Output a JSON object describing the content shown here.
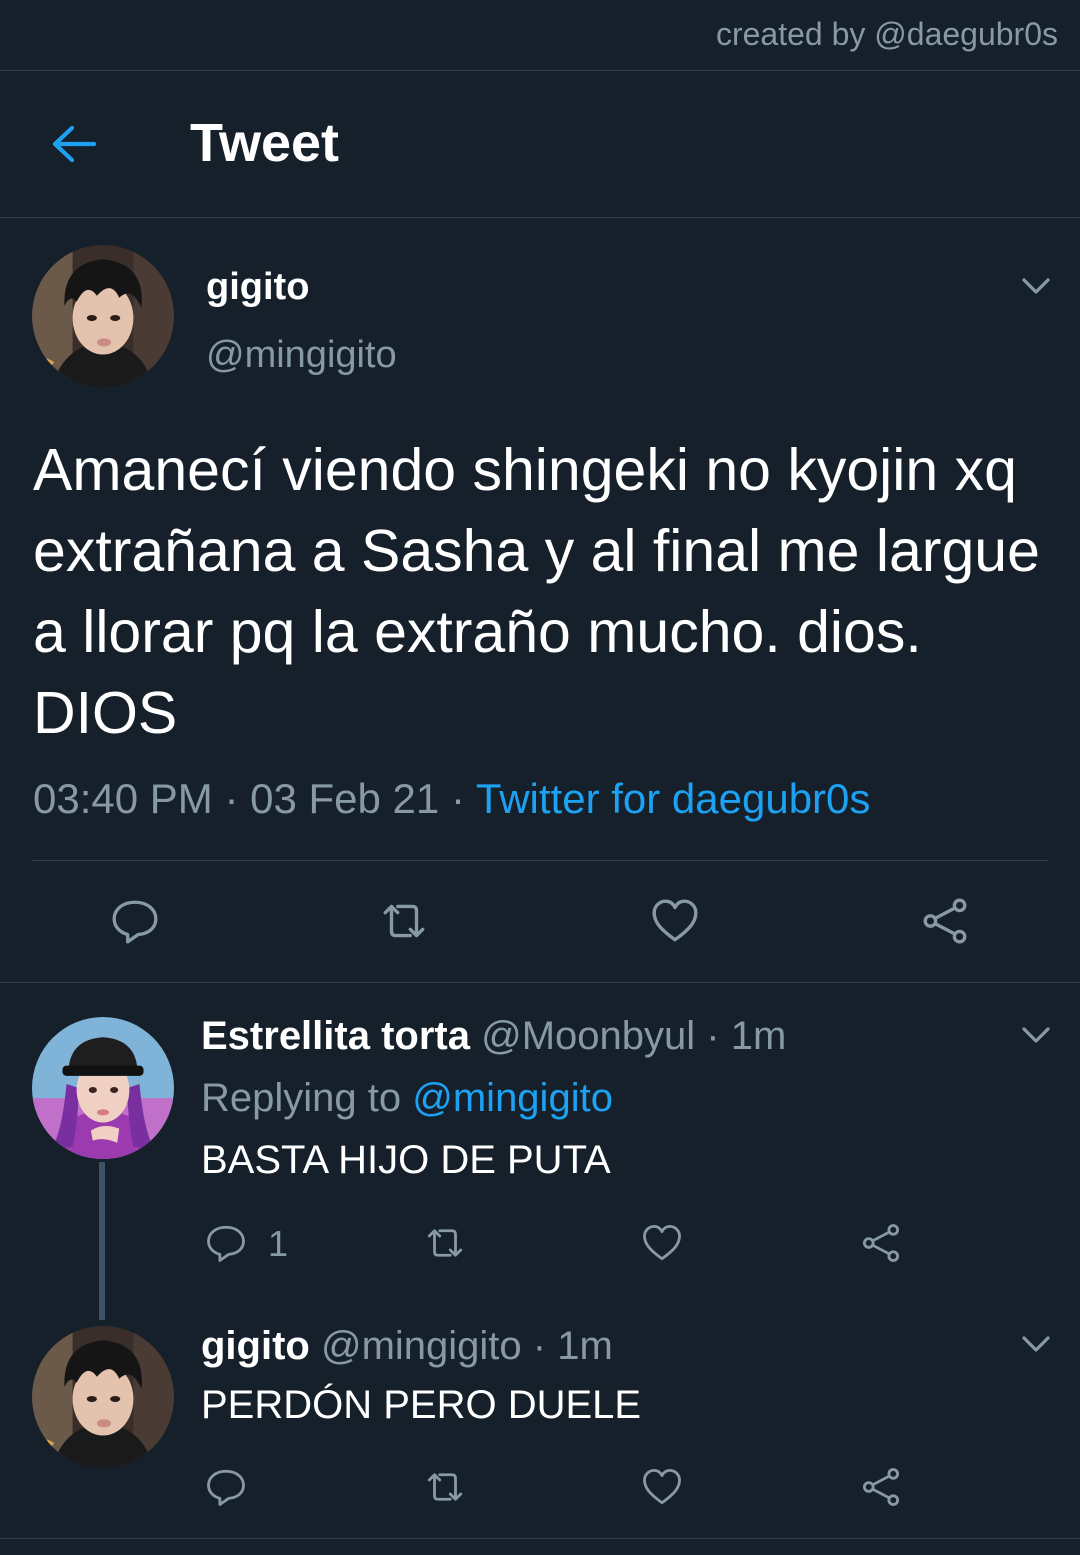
{
  "credit": "created by @daegubr0s",
  "header": {
    "title": "Tweet"
  },
  "tweet": {
    "name": "gigito",
    "handle": "@mingigito",
    "text": "Amanecí viendo shingeki no kyojin xq extrañana a Sasha y al final me largue a llorar pq la extraño mucho. dios. DIOS",
    "time": "03:40 PM",
    "date": "03 Feb 21",
    "separator": "·",
    "source": "Twitter for daegubr0s"
  },
  "replies": [
    {
      "name": "Estrellita torta",
      "handle": "@Moonbyul",
      "time": "1m",
      "separator": "·",
      "replying_label": "Replying to",
      "replying_to": "@mingigito",
      "text": "BASTA HIJO DE PUTA",
      "reply_count": "1"
    },
    {
      "name": "gigito",
      "handle": "@mingigito",
      "time": "1m",
      "separator": "·",
      "text": "PERDÓN PERO DUELE"
    }
  ],
  "icons": {
    "back": "back-arrow-icon",
    "chevron": "chevron-down-icon",
    "reply": "reply-icon",
    "retweet": "retweet-icon",
    "like": "heart-icon",
    "share": "share-icon"
  },
  "colors": {
    "background": "#15202b",
    "accent": "#1da1f2",
    "muted": "#8899a6",
    "divider": "#2f3b47"
  }
}
